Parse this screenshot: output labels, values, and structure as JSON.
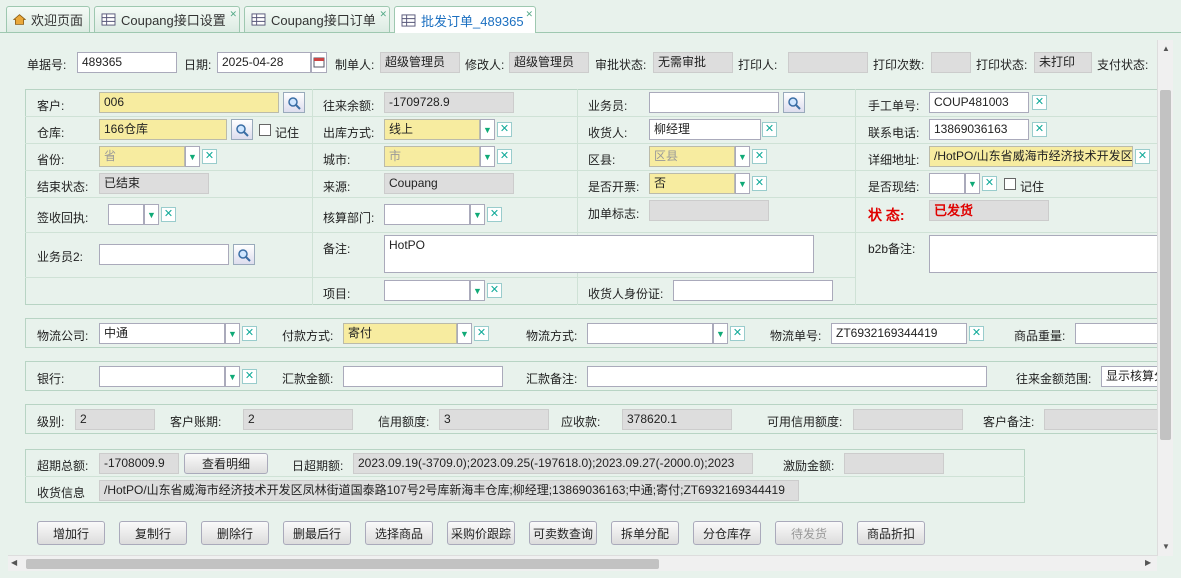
{
  "tabs": [
    {
      "label": "欢迎页面",
      "icon": "home-icon"
    },
    {
      "label": "Coupang接口设置",
      "icon": "table-icon"
    },
    {
      "label": "Coupang接口订单",
      "icon": "table-icon"
    },
    {
      "label": "批发订单_489365",
      "icon": "table-icon"
    }
  ],
  "header": {
    "doc_no_label": "单据号:",
    "doc_no": "489365",
    "date_label": "日期:",
    "date": "2025-04-28",
    "creator_label": "制单人:",
    "creator": "超级管理员",
    "modifier_label": "修改人:",
    "modifier": "超级管理员",
    "approval_label": "审批状态:",
    "approval": "无需审批",
    "printer_label": "打印人:",
    "printer": "",
    "print_count_label": "打印次数:",
    "print_count": "",
    "print_status_label": "打印状态:",
    "print_status": "未打印",
    "pay_status_label": "支付状态:"
  },
  "form": {
    "customer_label": "客户:",
    "customer": "006",
    "balance_label": "往来余额:",
    "balance": "-1709728.9",
    "salesman_label": "业务员:",
    "salesman": "",
    "manual_no_label": "手工单号:",
    "manual_no": "COUP481003",
    "warehouse_label": "仓库:",
    "warehouse": "166仓库",
    "remember_label": "记住",
    "ship_method_label": "出库方式:",
    "ship_method": "线上",
    "receiver_label": "收货人:",
    "receiver": "柳经理",
    "phone_label": "联系电话:",
    "phone": "13869036163",
    "province_label": "省份:",
    "province": "省",
    "city_label": "城市:",
    "city": "市",
    "district_label": "区县:",
    "district": "区县",
    "address_label": "详细地址:",
    "address": "/HotPO/山东省威海市经济技术开发区",
    "close_status_label": "结束状态:",
    "close_status": "已结束",
    "source_label": "来源:",
    "source": "Coupang",
    "invoice_label": "是否开票:",
    "invoice": "否",
    "cash_settle_label": "是否现结:",
    "cash_settle": "",
    "remember2_label": "记住",
    "sign_receipt_label": "签收回执:",
    "sign_receipt": "",
    "audit_dept_label": "核算部门:",
    "audit_dept": "",
    "add_flag_label": "加单标志:",
    "add_flag": "",
    "status_label": "状 态:",
    "status": "已发货",
    "salesman2_label": "业务员2:",
    "salesman2": "",
    "remark_label": "备注:",
    "remark": "HotPO",
    "b2b_remark_label": "b2b备注:",
    "b2b_remark": "",
    "project_label": "项目:",
    "project": "",
    "receiver_id_label": "收货人身份证:",
    "receiver_id": ""
  },
  "logistics": {
    "company_label": "物流公司:",
    "company": "中通",
    "payment_label": "付款方式:",
    "payment": "寄付",
    "method_label": "物流方式:",
    "method": "",
    "tracking_label": "物流单号:",
    "tracking": "ZT6932169344419",
    "weight_label": "商品重量:",
    "weight": ""
  },
  "bank": {
    "bank_label": "银行:",
    "bank": "",
    "amount_label": "汇款金额:",
    "amount": "",
    "remark_label": "汇款备注:",
    "remark": "",
    "range_label": "往来金额范围:",
    "range": "显示核算分"
  },
  "credit": {
    "level_label": "级别:",
    "level": "2",
    "period_label": "客户账期:",
    "period": "2",
    "limit_label": "信用额度:",
    "limit": "3",
    "receivable_label": "应收款:",
    "receivable": "378620.1",
    "available_label": "可用信用额度:",
    "available": "",
    "cust_remark_label": "客户备注:",
    "cust_remark": ""
  },
  "overdue": {
    "total_label": "超期总额:",
    "total": "-1708009.9",
    "detail_button": "查看明细",
    "daily_label": "日超期额:",
    "daily": "2023.09.19(-3709.0);2023.09.25(-197618.0);2023.09.27(-2000.0);2023",
    "incentive_label": "激励金额:",
    "incentive": "",
    "receipt_label": "收货信息",
    "receipt": "/HotPO/山东省威海市经济技术开发区凤林街道国泰路107号2号库新海丰仓库;柳经理;13869036163;中通;寄付;ZT6932169344419"
  },
  "toolbar": [
    "增加行",
    "复制行",
    "删除行",
    "删最后行",
    "选择商品",
    "采购价跟踪",
    "可卖数查询",
    "拆单分配",
    "分仓库存",
    "待发货",
    "商品折扣"
  ],
  "colors": {
    "accent": "#1b6fc0",
    "status_red": "#e00000",
    "bg": "#e8f2ec",
    "yellow_field": "#f7eca0"
  }
}
